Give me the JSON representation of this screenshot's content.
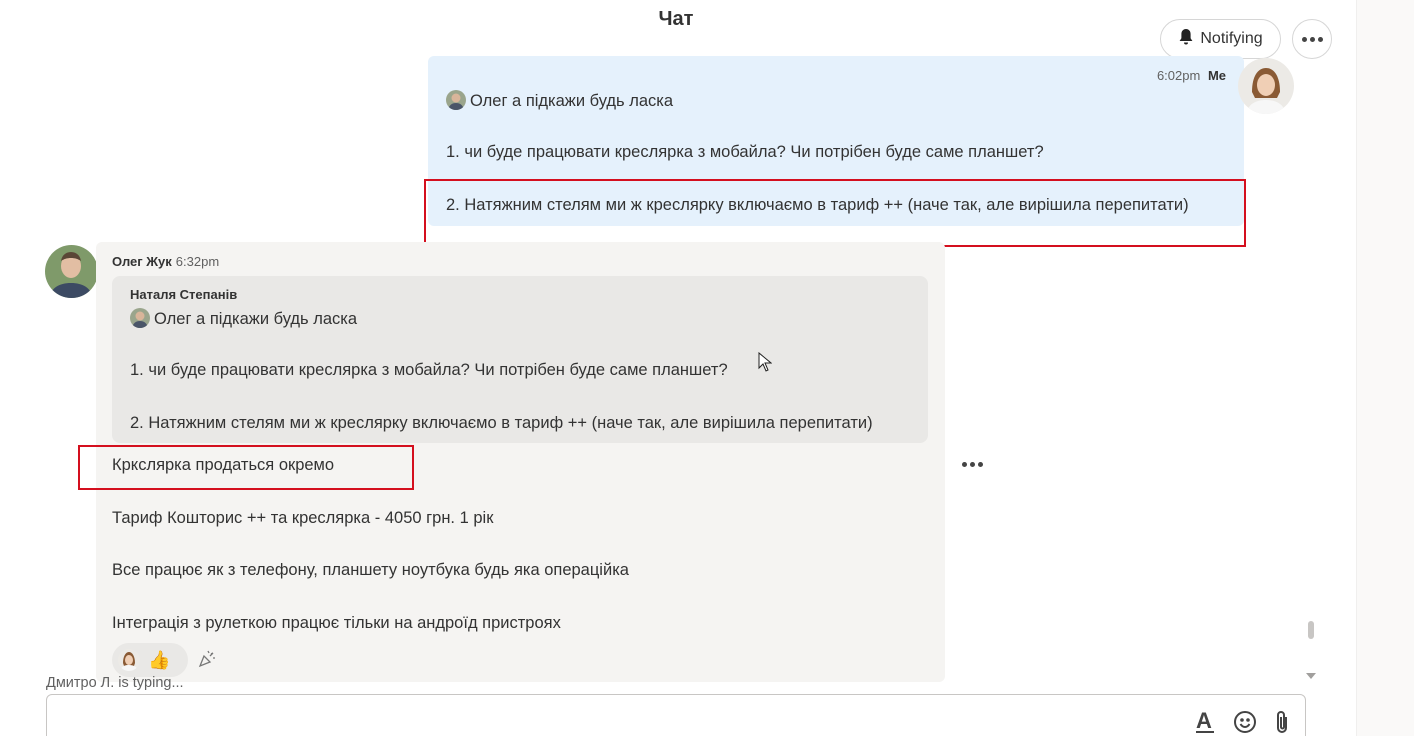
{
  "header": {
    "title": "Чат",
    "notify_label": "Notifying"
  },
  "my_message": {
    "time": "6:02pm",
    "author": "Me",
    "line1": "Олег а підкажи будь ласка",
    "line2": "1. чи буде працювати креслярка з мобайла? Чи потрібен буде саме планшет?",
    "line3": "2. Натяжним стелям ми ж креслярку включаємо в тариф ++ (наче так, але вирішила перепитати)"
  },
  "reply_message": {
    "author": "Олег Жук",
    "time": "6:32pm",
    "quote": {
      "author": "Наталя Степанів",
      "line1": "Олег а підкажи будь ласка",
      "line2": "1. чи буде працювати креслярка з мобайла? Чи потрібен буде саме планшет?",
      "line3": "2. Натяжним стелям ми ж креслярку включаємо в тариф ++ (наче так, але вирішила перепитати)"
    },
    "line1": "Кркслярка продаться окремо",
    "line2": "Тариф Кошторис ++ та креслярка - 4050 грн. 1 рік",
    "line3": "Все працює як з телефону, планшету ноутбука будь яка операційка",
    "line4": "Інтеграція з рулеткою працює тільки на андроїд пристроях",
    "reaction_emoji": "👍"
  },
  "typing_indicator": "Дмитро Л. is typing...",
  "colors": {
    "my_bubble": "#e5f1fc",
    "their_bubble": "#f5f4f2",
    "highlight": "#d40f1e"
  }
}
